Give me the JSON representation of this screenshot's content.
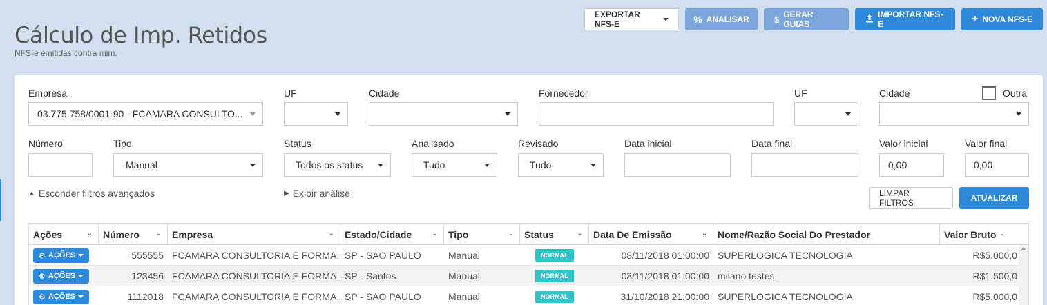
{
  "header": {
    "title": "Cálculo de Imp. Retidos",
    "subtitle": "NFS-e emitidas contra mim."
  },
  "toolbar": {
    "exportar": "EXPORTAR NFS-E",
    "analisar": "ANALISAR",
    "gerar_guias": "GERAR GUIAS",
    "importar": "IMPORTAR NFS-E",
    "nova": "NOVA NFS-E"
  },
  "filters": {
    "empresa_label": "Empresa",
    "empresa_value": "03.775.758/0001-90 - FCAMARA CONSULTO...",
    "uf1_label": "UF",
    "uf1_value": "",
    "cidade1_label": "Cidade",
    "cidade1_value": "",
    "fornecedor_label": "Fornecedor",
    "fornecedor_value": "",
    "uf2_label": "UF",
    "uf2_value": "",
    "cidade2_label": "Cidade",
    "cidade2_value": "",
    "outra_label": "Outra",
    "numero_label": "Número",
    "numero_value": "",
    "tipo_label": "Tipo",
    "tipo_value": "Manual",
    "status_label": "Status",
    "status_value": "Todos os status",
    "analisado_label": "Analisado",
    "analisado_value": "Tudo",
    "revisado_label": "Revisado",
    "revisado_value": "Tudo",
    "data_inicial_label": "Data inicial",
    "data_inicial_value": "",
    "data_final_label": "Data final",
    "data_final_value": "",
    "valor_inicial_label": "Valor inicial",
    "valor_inicial_value": "0,00",
    "valor_final_label": "Valor final",
    "valor_final_value": "0,00",
    "esconder_link": "Esconder filtros avançados",
    "exibir_link": "Exibir análise",
    "limpar": "LIMPAR FILTROS",
    "atualizar": "ATUALIZAR"
  },
  "table": {
    "columns": [
      "Ações",
      "Número",
      "Empresa",
      "Estado/Cidade",
      "Tipo",
      "Status",
      "Data De Emissão",
      "Nome/Razão Social Do Prestador",
      "Valor Bruto"
    ],
    "acoes_label": "AÇÕES",
    "rows": [
      {
        "numero": "555555",
        "empresa": "FCAMARA CONSULTORIA E FORMA...",
        "estado": "SP - SAO PAULO",
        "tipo": "Manual",
        "status": "NORMAL",
        "data": "08/11/2018 01:00:00",
        "prestador": "SUPERLOGICA TECNOLOGIA",
        "valor": "R$5.000,0"
      },
      {
        "numero": "123456",
        "empresa": "FCAMARA CONSULTORIA E FORMA...",
        "estado": "SP - Santos",
        "tipo": "Manual",
        "status": "NORMAL",
        "data": "08/11/2018 01:00:00",
        "prestador": "milano testes",
        "valor": "R$1.500,0"
      },
      {
        "numero": "1112018",
        "empresa": "FCAMARA CONSULTORIA E FORMA...",
        "estado": "SP - SAO PAULO",
        "tipo": "Manual",
        "status": "NORMAL",
        "data": "31/10/2018 21:00:00",
        "prestador": "SUPERLOGICA TECNOLOGIA",
        "valor": "R$5.000,0"
      }
    ]
  }
}
